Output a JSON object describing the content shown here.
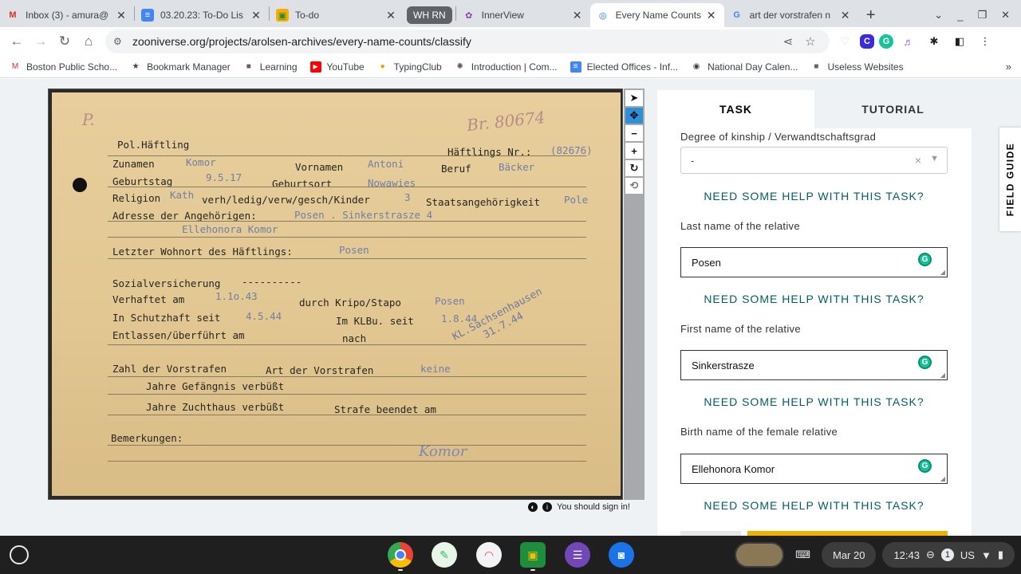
{
  "tabs": [
    {
      "title": "Inbox (3) - amura@",
      "icon": "gmail-icon",
      "color": "#d93025",
      "glyph": "M"
    },
    {
      "title": "03.20.23: To-Do Lis",
      "icon": "docs-icon",
      "color": "#4285f4",
      "glyph": "≡"
    },
    {
      "title": "To-do",
      "icon": "classroom-icon",
      "color": "#f9ab00",
      "glyph": "▣"
    },
    {
      "title": "WH RN",
      "group": true
    },
    {
      "title": "InnerView",
      "icon": "innerview-icon",
      "color": "#8e44ad",
      "glyph": "✿"
    },
    {
      "title": "Every Name Counts",
      "icon": "zooniverse-icon",
      "color": "#1a73e8",
      "glyph": "◎",
      "active": true
    },
    {
      "title": "art der vorstrafen n",
      "icon": "google-icon",
      "color": "#4285f4",
      "glyph": "G"
    }
  ],
  "toolbar": {
    "url": "zooniverse.org/projects/arolsen-archives/every-name-counts/classify"
  },
  "bookmarks": [
    {
      "label": "Boston Public Scho...",
      "icon": "gmail-icon",
      "color": "#d93025",
      "glyph": "M"
    },
    {
      "label": "Bookmark Manager",
      "icon": "star-icon",
      "color": "#202124",
      "glyph": "★"
    },
    {
      "label": "Learning",
      "icon": "folder-icon",
      "color": "#5f6368",
      "glyph": "■"
    },
    {
      "label": "YouTube",
      "icon": "youtube-icon",
      "color": "#ff0000",
      "glyph": "▶"
    },
    {
      "label": "TypingClub",
      "icon": "typingclub-icon",
      "color": "#f29900",
      "glyph": "●"
    },
    {
      "label": "Introduction | Com...",
      "icon": "openai-icon",
      "color": "#555",
      "glyph": "✺"
    },
    {
      "label": "Elected Offices - Inf...",
      "icon": "docs-icon",
      "color": "#4285f4",
      "glyph": "≡"
    },
    {
      "label": "National Day Calen...",
      "icon": "globe-icon",
      "color": "#202124",
      "glyph": "◉"
    },
    {
      "label": "Useless Websites",
      "icon": "folder-icon",
      "color": "#5f6368",
      "glyph": "■"
    }
  ],
  "card": {
    "reg_number": "Br. 80674",
    "corner_mark": "P.",
    "header": "Pol.Häftling",
    "prisoner_no_label": "Häftlings Nr.:",
    "prisoner_no": "(82676)",
    "surname_label": "Zunamen",
    "surname": "Komor",
    "firstname_label": "Vornamen",
    "firstname": "Antoni",
    "job_label": "Beruf",
    "job": "Bäcker",
    "birthday_label": "Geburtstag",
    "birthday": "9.5.17",
    "birthplace_label": "Geburtsort",
    "birthplace": "Nowawies",
    "religion_label": "Religion",
    "religion": "Kath",
    "marital": "verh/ledig/verw/gesch/Kinder",
    "children": "3",
    "nationality_label": "Staatsangehörigkeit",
    "nationality": "Pole",
    "relatives_label": "Adresse der Angehörigen:",
    "relatives_address": "Posen . Sinkerstrasze 4",
    "relatives_name": "Ellehonora Komor",
    "last_residence_label": "Letzter Wohnort des Häftlings:",
    "last_residence": "Posen",
    "social_label": "Sozialversicherung",
    "social": "----------",
    "arrested_label": "Verhaftet am",
    "arrested": "1.1o.43",
    "by_label": "durch Kripo/Stapo",
    "by": "Posen",
    "custody_label": "In Schutzhaft seit",
    "custody": "4.5.44",
    "camp_label": "Im KLBu. seit",
    "camp": "1.8.44",
    "released_label": "Entlassen/überführt am",
    "to_label": "nach",
    "stamp_line1": "KL.Sachsenhausen",
    "stamp_line2": "31.7.44",
    "convictions_label": "Zahl der Vorstrafen",
    "type_label": "Art der Vorstrafen",
    "type": "keine",
    "prison_label": "Jahre Gefängnis verbüßt",
    "penitentiary_label": "Jahre Zuchthaus verbüßt",
    "sentence_label": "Strafe beendet am",
    "remarks_label": "Bemerkungen:",
    "signature": "Komor"
  },
  "viewer": {
    "signin": "You should sign in!"
  },
  "panel": {
    "tab_task": "TASK",
    "tab_tutorial": "TUTORIAL",
    "kinship_label": "Degree of kinship / Verwandtschaftsgrad",
    "kinship_value": "-",
    "help": "NEED SOME HELP WITH THIS TASK?",
    "last_name_label": "Last name of the relative",
    "last_name_value": "Posen",
    "first_name_label": "First name of the relative",
    "first_name_value": "Sinkerstrasze",
    "birth_name_label": "Birth name of the female relative",
    "birth_name_value": "Ellehonora Komor",
    "field_guide": "FIELD GUIDE"
  },
  "shelf": {
    "date": "Mar 20",
    "time": "12:43",
    "notifications": "1",
    "locale": "US",
    "apps": [
      {
        "name": "chrome-app",
        "color": "#4285f4",
        "glyph": "◉"
      },
      {
        "name": "evernote-app",
        "color": "#2dbe60",
        "glyph": "✎"
      },
      {
        "name": "paint-app",
        "color": "#e8eaed",
        "glyph": "◠"
      },
      {
        "name": "classroom-app",
        "color": "#1e8e3e",
        "glyph": "▣"
      },
      {
        "name": "forms-app",
        "color": "#7248b9",
        "glyph": "☰"
      },
      {
        "name": "camera-app",
        "color": "#1a73e8",
        "glyph": "◙"
      }
    ]
  }
}
